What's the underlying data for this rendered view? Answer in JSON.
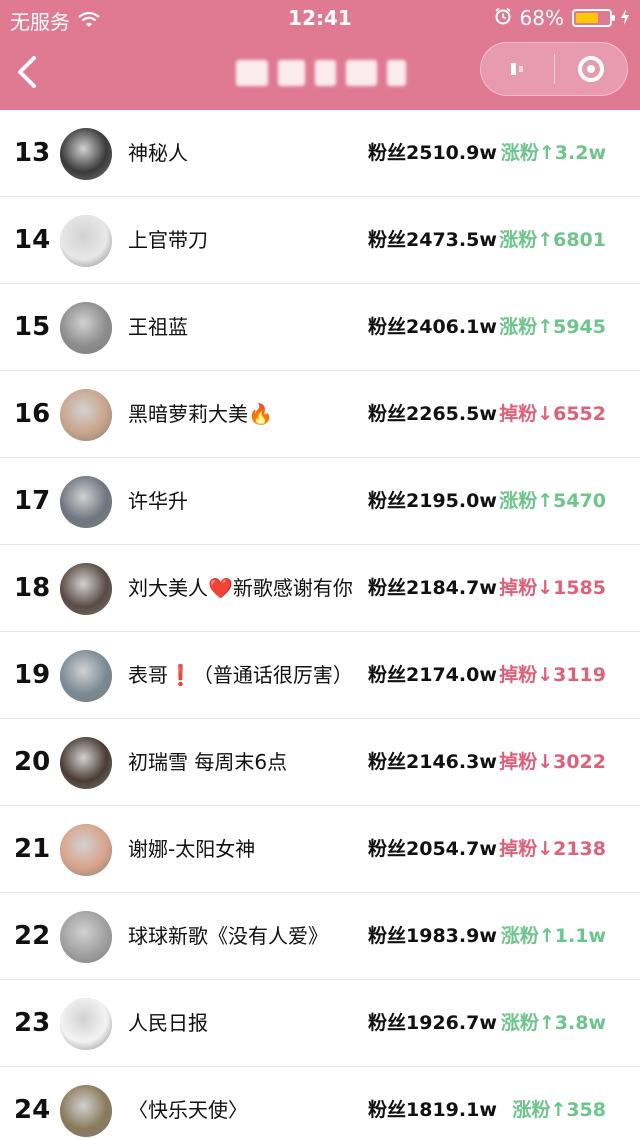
{
  "status_bar": {
    "carrier": "无服务",
    "time": "12:41",
    "battery": "68%",
    "battery_level": 0.68
  },
  "colors": {
    "header_bg": "#e07a93",
    "gain": "#6cc58a",
    "loss": "#e0607a"
  },
  "rows": [
    {
      "rank": "13",
      "name": "神秘人",
      "fans": "粉丝2510.9w",
      "change": "涨粉↑3.2w",
      "dir": "up",
      "avatar_color": "#3a3a3a"
    },
    {
      "rank": "14",
      "name": "上官带刀",
      "fans": "粉丝2473.5w",
      "change": "涨粉↑6801",
      "dir": "up",
      "avatar_color": "#e8e8e8"
    },
    {
      "rank": "15",
      "name": "王祖蓝",
      "fans": "粉丝2406.1w",
      "change": "涨粉↑5945",
      "dir": "up",
      "avatar_color": "#8d8d8d"
    },
    {
      "rank": "16",
      "name": "黑暗萝莉大美🔥",
      "fans": "粉丝2265.5w",
      "change": "掉粉↓6552",
      "dir": "down",
      "avatar_color": "#c9a48a"
    },
    {
      "rank": "17",
      "name": "许华升",
      "fans": "粉丝2195.0w",
      "change": "涨粉↑5470",
      "dir": "up",
      "avatar_color": "#6f7580"
    },
    {
      "rank": "18",
      "name": "刘大美人❤️新歌感谢有你",
      "fans": "粉丝2184.7w",
      "change": "掉粉↓1585",
      "dir": "down",
      "avatar_color": "#5a4a44"
    },
    {
      "rank": "19",
      "name": "表哥❗（普通话很厉害）",
      "fans": "粉丝2174.0w",
      "change": "掉粉↓3119",
      "dir": "down",
      "avatar_color": "#7a8a94"
    },
    {
      "rank": "20",
      "name": "初瑞雪 每周末6点",
      "fans": "粉丝2146.3w",
      "change": "掉粉↓3022",
      "dir": "down",
      "avatar_color": "#4a3c34"
    },
    {
      "rank": "21",
      "name": "谢娜-太阳女神",
      "fans": "粉丝2054.7w",
      "change": "掉粉↓2138",
      "dir": "down",
      "avatar_color": "#d9a38a"
    },
    {
      "rank": "22",
      "name": "球球新歌《没有人爱》",
      "fans": "粉丝1983.9w",
      "change": "涨粉↑1.1w",
      "dir": "up",
      "avatar_color": "#a0a0a0"
    },
    {
      "rank": "23",
      "name": "人民日报",
      "fans": "粉丝1926.7w",
      "change": "涨粉↑3.8w",
      "dir": "up",
      "avatar_color": "#f3f3f3"
    },
    {
      "rank": "24",
      "name": "〈快乐天使〉",
      "fans": "粉丝1819.1w",
      "change": "涨粉↑358",
      "dir": "up",
      "avatar_color": "#8a7a5a"
    }
  ]
}
